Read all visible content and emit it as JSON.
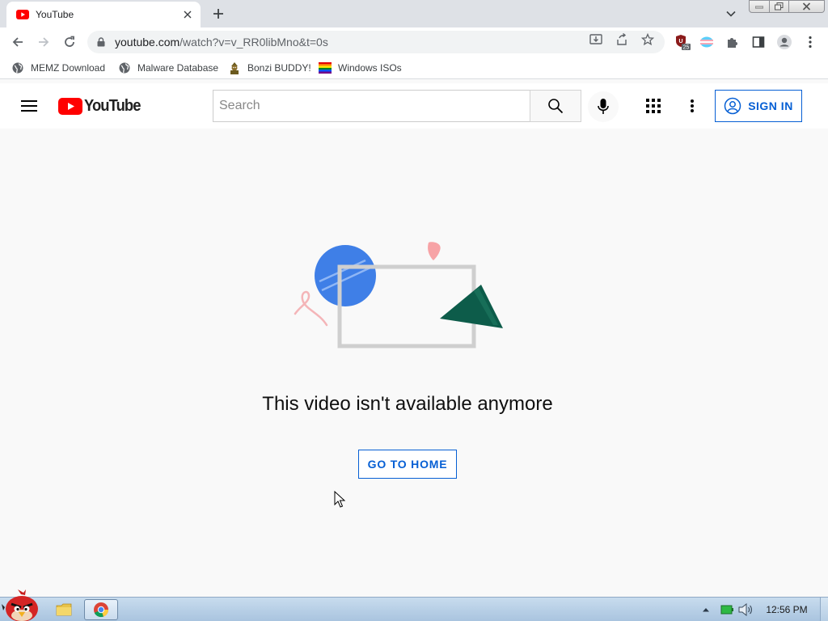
{
  "browser": {
    "tab": {
      "title": "YouTube",
      "favicon": "youtube-favicon-icon",
      "close_icon": "close-icon"
    },
    "new_tab_icon": "plus-icon",
    "tab_search_icon": "chevron-down-icon",
    "window_controls": [
      "minimize-icon",
      "maximize-icon",
      "close-icon"
    ],
    "nav": {
      "back_icon": "arrow-left-icon",
      "forward_icon": "arrow-right-icon",
      "reload_icon": "reload-icon"
    },
    "address": {
      "host": "youtube.com",
      "path": "/watch?v=v_RR0libMno&t=0s",
      "lock_icon": "lock-icon"
    },
    "omnibox_actions": [
      "install-icon",
      "share-icon",
      "star-icon"
    ],
    "extensions": [
      {
        "icon": "shield-extension-icon",
        "badge": "25"
      },
      {
        "icon": "flag-extension-icon"
      },
      {
        "icon": "puzzle-icon"
      },
      {
        "icon": "side-panel-icon"
      },
      {
        "icon": "profile-icon"
      },
      {
        "icon": "more-vertical-icon"
      }
    ],
    "bookmarks": [
      {
        "label": "MEMZ Download",
        "icon": "globe-icon"
      },
      {
        "label": "Malware Database",
        "icon": "globe-icon"
      },
      {
        "label": "Bonzi BUDDY!",
        "icon": "bonzi-icon"
      },
      {
        "label": "Windows ISOs",
        "icon": "rainbow-flag-icon"
      }
    ]
  },
  "youtube": {
    "header": {
      "menu_icon": "hamburger-menu-icon",
      "logo_text": "YouTube",
      "search_placeholder": "Search",
      "search_icon": "search-icon",
      "mic_icon": "microphone-icon",
      "apps_icon": "apps-grid-icon",
      "more_icon": "more-vertical-icon",
      "signin_label": "SIGN IN",
      "signin_icon": "account-circle-icon"
    },
    "error": {
      "message": "This video isn't available anymore",
      "home_button": "GO TO HOME"
    },
    "colors": {
      "brand_red": "#ff0000",
      "link_blue": "#065fd4",
      "page_bg": "#f9f9f9"
    }
  },
  "taskbar": {
    "start_icon": "angry-bird-start-icon",
    "pinned": [
      {
        "icon": "folder-icon",
        "active": false
      },
      {
        "icon": "chrome-icon",
        "active": true
      }
    ],
    "tray_icons": [
      "show-hidden-icons-arrow",
      "battery-icon",
      "volume-icon"
    ],
    "clock": "12:56 PM"
  }
}
